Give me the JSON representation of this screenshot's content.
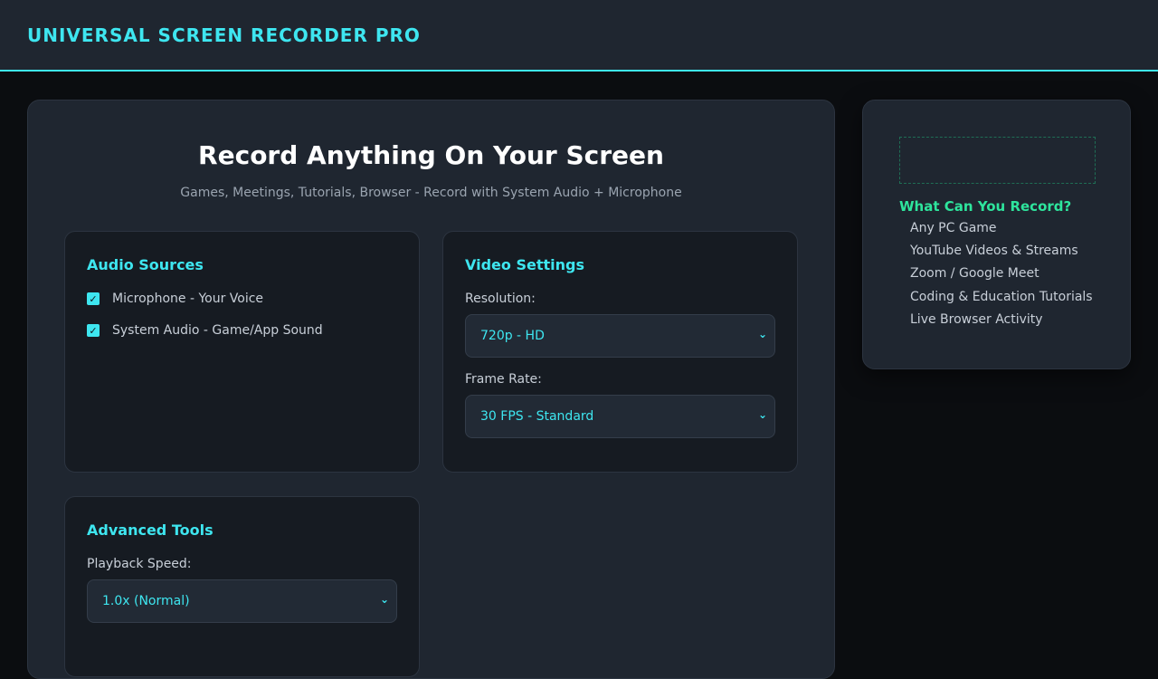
{
  "header": {
    "brand": "UNIVERSAL SCREEN RECORDER PRO"
  },
  "hero": {
    "title": "Record Anything On Your Screen",
    "subtitle": "Games, Meetings, Tutorials, Browser - Record with System Audio + Microphone"
  },
  "audio": {
    "title": "Audio Sources",
    "options": [
      {
        "label": "Microphone - Your Voice",
        "checked": true
      },
      {
        "label": "System Audio - Game/App Sound",
        "checked": true
      }
    ]
  },
  "video": {
    "title": "Video Settings",
    "resolution_label": "Resolution:",
    "resolution_value": "720p - HD",
    "framerate_label": "Frame Rate:",
    "framerate_value": "30 FPS - Standard"
  },
  "advanced": {
    "title": "Advanced Tools",
    "speed_label": "Playback Speed:",
    "speed_value": "1.0x (Normal)"
  },
  "sidebar": {
    "title": "What Can You Record?",
    "items": [
      "Any PC Game",
      "YouTube Videos & Streams",
      "Zoom / Google Meet",
      "Coding & Education Tutorials",
      "Live Browser Activity"
    ]
  },
  "icons": {
    "checkbox": "check-icon",
    "select": "chevron-down-icon"
  },
  "colors": {
    "accent": "#3ee6f0",
    "sidebar_heading": "#2ee59d",
    "background": "#0b0d10",
    "card": "#1f2630",
    "panel": "#161b22"
  }
}
